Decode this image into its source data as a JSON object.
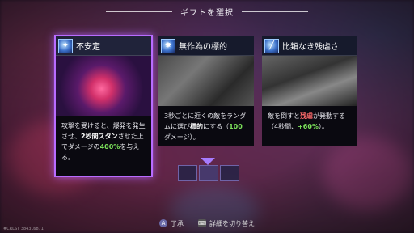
{
  "header": {
    "title": "ギフトを選択"
  },
  "cards": [
    {
      "name": "不安定",
      "selected": true,
      "desc": [
        {
          "t": "攻撃を受けると、爆発を発生させ、",
          "s": ""
        },
        {
          "t": "2秒間スタン",
          "s": "bold"
        },
        {
          "t": "させた上でダメージの",
          "s": ""
        },
        {
          "t": "400%",
          "s": "green"
        },
        {
          "t": "を与える。",
          "s": ""
        }
      ]
    },
    {
      "name": "無作為の標的",
      "selected": false,
      "desc": [
        {
          "t": "3秒ごとに近くの敵をランダムに選び",
          "s": ""
        },
        {
          "t": "標的",
          "s": "bold"
        },
        {
          "t": "にする（",
          "s": ""
        },
        {
          "t": "100",
          "s": "green"
        },
        {
          "t": "ダメージ）。",
          "s": ""
        }
      ]
    },
    {
      "name": "比類なき残虐さ",
      "selected": false,
      "desc": [
        {
          "t": "敵を倒すと",
          "s": ""
        },
        {
          "t": "残虐",
          "s": "red"
        },
        {
          "t": "が発動する（4秒間、",
          "s": ""
        },
        {
          "t": "+60%",
          "s": "green"
        },
        {
          "t": "）。",
          "s": ""
        }
      ]
    }
  ],
  "pager": {
    "slots": 3,
    "active_index": 1
  },
  "footer": {
    "confirm_key": "A",
    "confirm_label": "了承",
    "details_key": "⌨",
    "details_label": "詳細を切り替え"
  },
  "watermark": "#CRLST 3843L6871"
}
